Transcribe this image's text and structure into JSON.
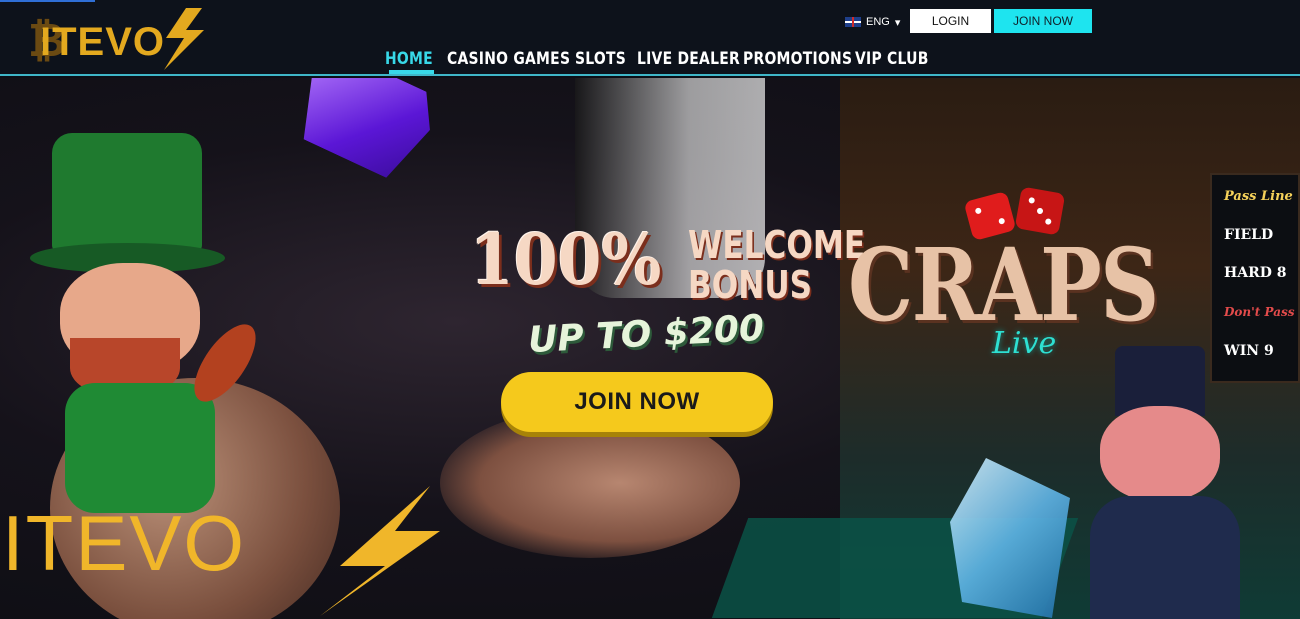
{
  "header": {
    "logo_text": "ITEVO",
    "language": "ENG",
    "language_caret": "▾",
    "login_label": "LOGIN",
    "join_label": "JOIN NOW"
  },
  "nav": {
    "items": [
      {
        "label": "HOME",
        "active": true
      },
      {
        "label": "CASINO GAMES",
        "active": false
      },
      {
        "label": "SLOTS",
        "active": false
      },
      {
        "label": "LIVE DEALER",
        "active": false
      },
      {
        "label": "PROMOTIONS",
        "active": false
      },
      {
        "label": "VIP CLUB",
        "active": false
      }
    ]
  },
  "hero": {
    "bonus_percent": "100%",
    "bonus_line1": "WELCOME",
    "bonus_line2": "BONUS",
    "up_to": "UP TO $200",
    "join_label": "JOIN NOW",
    "craps_title": "CRAPS",
    "craps_sub": "Live",
    "brand_bottom": "ITEVO",
    "board_rows": [
      "Pass Line",
      "FIELD",
      "HARD 8",
      "Don't Pass",
      "WIN 9"
    ]
  },
  "colors": {
    "accent": "#38d8e8",
    "join_button": "#1ee4ef",
    "hero_button": "#f5c91c",
    "brand_gold": "#e3a91f"
  }
}
